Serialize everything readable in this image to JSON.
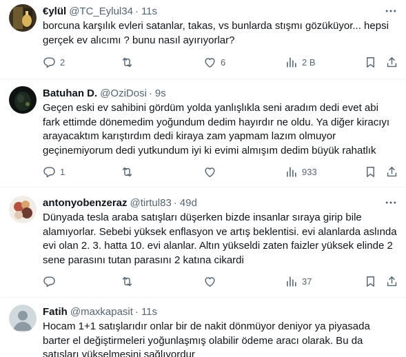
{
  "tweets": [
    {
      "name": "€ylül",
      "handle": "@TC_Eylul34",
      "separator": "·",
      "time": "11s",
      "text": "borcuna karşılık evleri satanlar, takas, vs bunlarda stışmı gözüküyor... hepsi gerçek ev alıcımı ? bunu nasıl ayırıyorlar?",
      "replies": "2",
      "reposts": "",
      "likes": "6",
      "views": "2 B"
    },
    {
      "name": "Batuhan D.",
      "handle": "@OziDosi",
      "separator": "·",
      "time": "9s",
      "text": "Geçen eski ev sahibini gördüm yolda yanlışlıkla seni aradım dedi evet abi fark ettimde dönemedim yoğundum dedim hayırdır ne oldu. Ya diğer kiracıyı arayacaktım karıştırdım dedi kiraya zam yapmam lazım olmuyor geçinemiyorum dedi yutkundum iyi ki evimi almışım dedim büyük rahatlık",
      "replies": "1",
      "reposts": "",
      "likes": "",
      "views": "933"
    },
    {
      "name": "antonyobenzeraz",
      "handle": "@tirtul83",
      "separator": "·",
      "time": "49d",
      "text": "Dünyada tesla araba satışları düşerken bizde insanlar sıraya girip bile alamıyorlar. Sebebi yüksek enflasyon ve artış beklentisi. evi alanlarda aslında evi olan 2. 3. hatta 10. evi alanlar. Altın yükseldi zaten faizler yüksek elinde 2 sene parasını tutan parasını 2 katına cikardi",
      "replies": "",
      "reposts": "",
      "likes": "",
      "views": "37"
    },
    {
      "name": "Fatih",
      "handle": "@maxkapasit",
      "separator": "·",
      "time": "11s",
      "text": "Hocam 1+1 satışlarıdır onlar bir de nakit dönmüyor deniyor ya piyasada barter el değiştirmeleri yoğunlaşmış olabilir ödeme aracı olarak. Bu da satışları yükselmesini sağlıyordur",
      "replies": "",
      "reposts": "",
      "likes": "",
      "views": ""
    }
  ],
  "icons": [
    "more-icon",
    "reply-icon",
    "repost-icon",
    "like-icon",
    "views-icon",
    "bookmark-icon",
    "share-icon"
  ],
  "colors": {
    "text": "#0f1419",
    "secondary": "#536471",
    "divider": "#eff3f4"
  }
}
